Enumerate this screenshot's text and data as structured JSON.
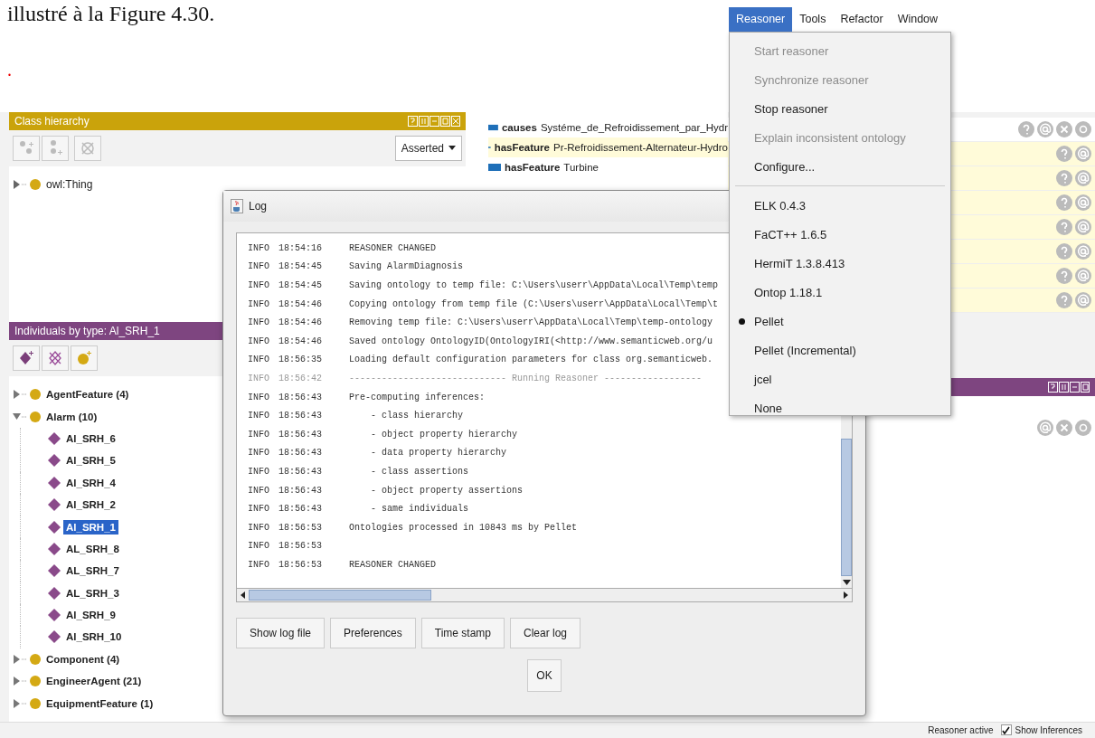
{
  "document": {
    "text_line": "illustré à la Figure 4.30.",
    "marker": "."
  },
  "class_hierarchy": {
    "title": "Class hierarchy",
    "mode": "Asserted",
    "tree": [
      {
        "label": "owl:Thing",
        "expanded": false,
        "selected": false
      }
    ]
  },
  "properties": [
    {
      "property": "causes",
      "value": "Systéme_de_Refroidissement_par_Hydr",
      "highlighted": false
    },
    {
      "property": "hasFeature",
      "value": "Pr-Refroidissement-Alternateur-Hydro",
      "highlighted": true
    },
    {
      "property": "hasFeature",
      "value": "Turbine",
      "highlighted": false
    }
  ],
  "annotation_rows": [
    {
      "kind": "header"
    },
    {
      "kind": "item"
    },
    {
      "kind": "item"
    },
    {
      "kind": "item"
    },
    {
      "kind": "item"
    },
    {
      "kind": "item"
    },
    {
      "kind": "item"
    },
    {
      "kind": "item"
    }
  ],
  "individuals": {
    "title": "Individuals by type: Al_SRH_1",
    "tree": [
      {
        "label": "AgentFeature (4)",
        "expanded": false,
        "selected": false
      },
      {
        "label": "Alarm (10)",
        "expanded": true,
        "selected": false,
        "children": [
          {
            "label": "Al_SRH_6",
            "selected": false
          },
          {
            "label": "Al_SRH_5",
            "selected": false
          },
          {
            "label": "Al_SRH_4",
            "selected": false
          },
          {
            "label": "Al_SRH_2",
            "selected": false
          },
          {
            "label": "Al_SRH_1",
            "selected": true
          },
          {
            "label": "AL_SRH_8",
            "selected": false
          },
          {
            "label": "AL_SRH_7",
            "selected": false
          },
          {
            "label": "AL_SRH_3",
            "selected": false
          },
          {
            "label": "Al_SRH_9",
            "selected": false
          },
          {
            "label": "Al_SRH_10",
            "selected": false
          }
        ]
      },
      {
        "label": "Component (4)",
        "expanded": false,
        "selected": false
      },
      {
        "label": "EngineerAgent (21)",
        "expanded": false,
        "selected": false
      },
      {
        "label": "EquipmentFeature (1)",
        "expanded": false,
        "selected": false
      }
    ]
  },
  "log": {
    "title": "Log",
    "lines": [
      {
        "level": "INFO",
        "time": "18:54:16",
        "message": "REASONER CHANGED",
        "dimmed": false
      },
      {
        "level": "INFO",
        "time": "18:54:45",
        "message": "Saving AlarmDiagnosis",
        "dimmed": false
      },
      {
        "level": "INFO",
        "time": "18:54:45",
        "message": "Saving ontology to temp file: C:\\Users\\userr\\AppData\\Local\\Temp\\temp",
        "dimmed": false
      },
      {
        "level": "INFO",
        "time": "18:54:46",
        "message": "Copying ontology from temp file (C:\\Users\\userr\\AppData\\Local\\Temp\\t",
        "dimmed": false
      },
      {
        "level": "INFO",
        "time": "18:54:46",
        "message": "Removing temp file: C:\\Users\\userr\\AppData\\Local\\Temp\\temp-ontology",
        "dimmed": false
      },
      {
        "level": "INFO",
        "time": "18:54:46",
        "message": "Saved ontology OntologyID(OntologyIRI(<http://www.semanticweb.org/u",
        "dimmed": false
      },
      {
        "level": "INFO",
        "time": "18:56:35",
        "message": "Loading default configuration parameters for class org.semanticweb.",
        "dimmed": false
      },
      {
        "level": "INFO",
        "time": "18:56:42",
        "message": "----------------------------- Running Reasoner ------------------",
        "dimmed": true
      },
      {
        "level": "INFO",
        "time": "18:56:43",
        "message": "Pre-computing inferences:",
        "dimmed": false
      },
      {
        "level": "INFO",
        "time": "18:56:43",
        "message": "    - class hierarchy",
        "dimmed": false
      },
      {
        "level": "INFO",
        "time": "18:56:43",
        "message": "    - object property hierarchy",
        "dimmed": false
      },
      {
        "level": "INFO",
        "time": "18:56:43",
        "message": "    - data property hierarchy",
        "dimmed": false
      },
      {
        "level": "INFO",
        "time": "18:56:43",
        "message": "    - class assertions",
        "dimmed": false
      },
      {
        "level": "INFO",
        "time": "18:56:43",
        "message": "    - object property assertions",
        "dimmed": false
      },
      {
        "level": "INFO",
        "time": "18:56:43",
        "message": "    - same individuals",
        "dimmed": false
      },
      {
        "level": "INFO",
        "time": "18:56:53",
        "message": "Ontologies processed in 10843 ms by Pellet",
        "dimmed": false
      },
      {
        "level": "INFO",
        "time": "18:56:53",
        "dimmed": false
      },
      {
        "level": "INFO",
        "time": "18:56:53",
        "message": "REASONER CHANGED",
        "dimmed": false
      }
    ],
    "buttons": [
      "Show log file",
      "Preferences",
      "Time stamp",
      "Clear log"
    ],
    "ok": "OK"
  },
  "menu": {
    "bar": [
      {
        "label": "Reasoner",
        "selected": true
      },
      {
        "label": "Tools",
        "selected": false
      },
      {
        "label": "Refactor",
        "selected": false
      },
      {
        "label": "Window",
        "selected": false
      }
    ],
    "items": [
      {
        "kind": "item",
        "label": "Start reasoner",
        "disabled": true,
        "selected": false
      },
      {
        "kind": "item",
        "label": "Synchronize reasoner",
        "disabled": true,
        "selected": false
      },
      {
        "kind": "item",
        "label": "Stop reasoner",
        "disabled": false,
        "selected": false
      },
      {
        "kind": "item",
        "label": "Explain inconsistent ontology",
        "disabled": true,
        "selected": false
      },
      {
        "kind": "item",
        "label": "Configure...",
        "disabled": false,
        "selected": false
      },
      {
        "kind": "separator"
      },
      {
        "kind": "radio",
        "label": "ELK 0.4.3",
        "disabled": false,
        "selected": false
      },
      {
        "kind": "radio",
        "label": "FaCT++ 1.6.5",
        "disabled": false,
        "selected": false
      },
      {
        "kind": "radio",
        "label": "HermiT 1.3.8.413",
        "disabled": false,
        "selected": false
      },
      {
        "kind": "radio",
        "label": "Ontop 1.18.1",
        "disabled": false,
        "selected": false
      },
      {
        "kind": "radio",
        "label": "Pellet",
        "disabled": false,
        "selected": true
      },
      {
        "kind": "radio",
        "label": "Pellet (Incremental)",
        "disabled": false,
        "selected": false
      },
      {
        "kind": "radio",
        "label": "jcel",
        "disabled": false,
        "selected": false
      },
      {
        "kind": "radio",
        "label": "None",
        "disabled": false,
        "selected": false
      }
    ]
  },
  "status_bar": {
    "status": "Reasoner active",
    "show_inferences": {
      "label": "Show Inferences",
      "checked": true
    }
  }
}
